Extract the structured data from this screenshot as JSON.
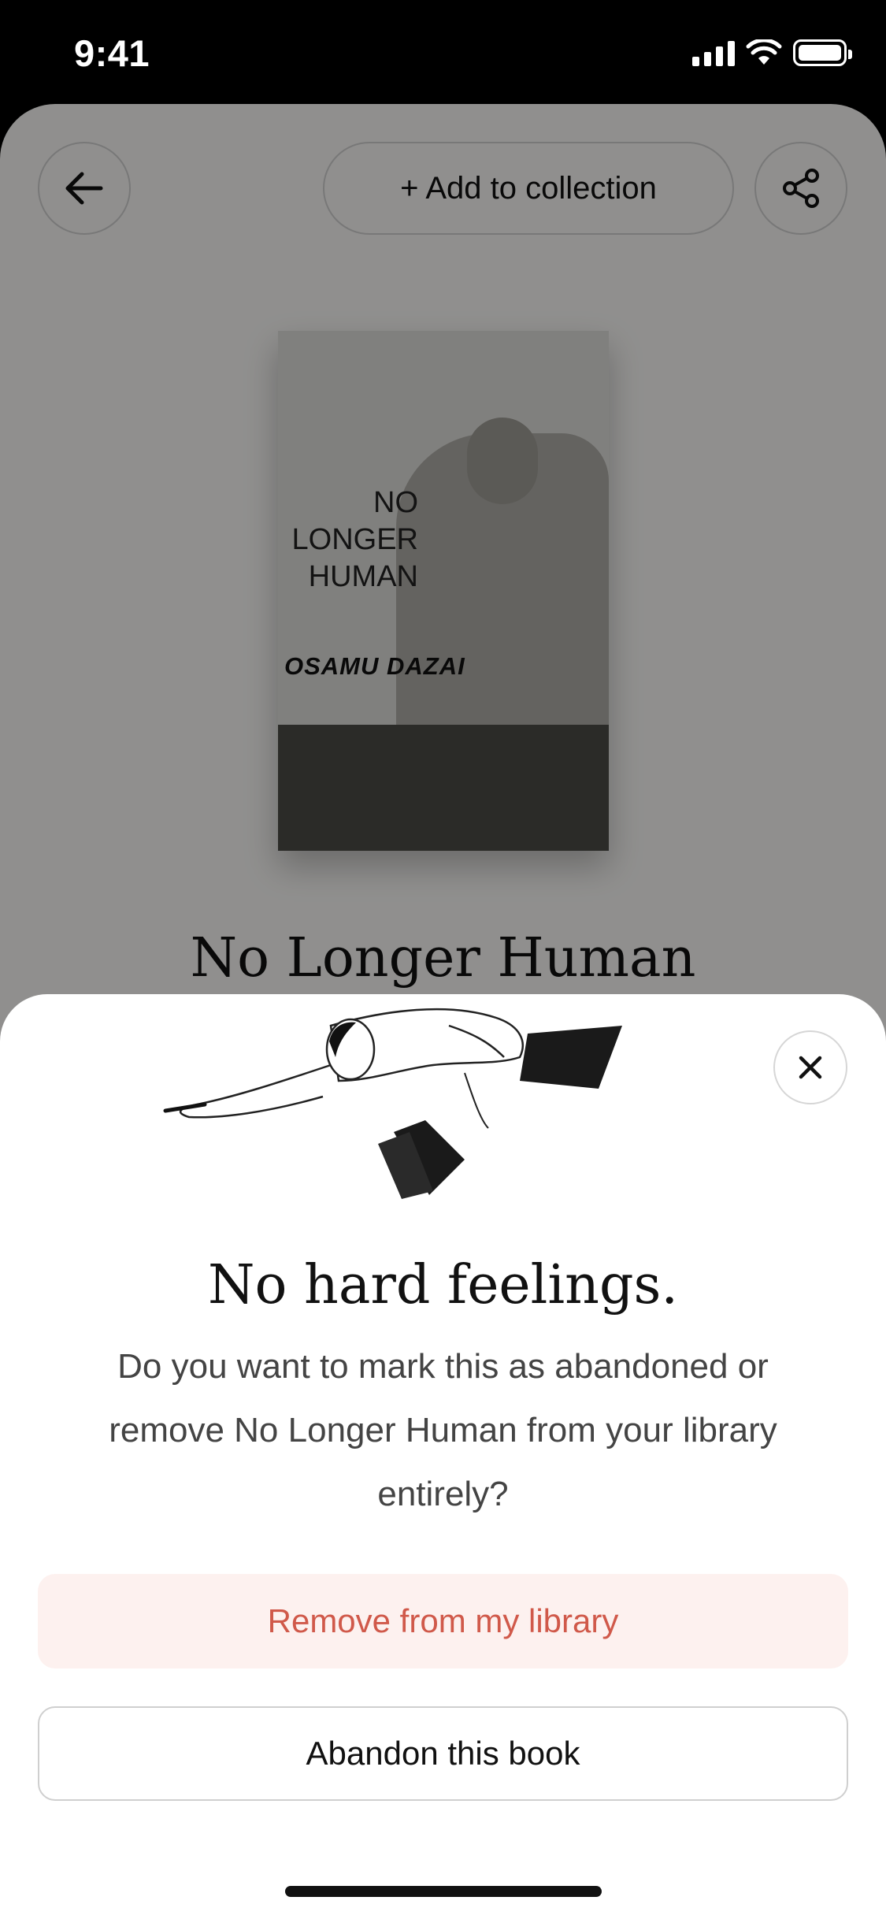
{
  "status_bar": {
    "time": "9:41"
  },
  "header": {
    "add_to_collection_label": "+ Add to collection"
  },
  "book": {
    "title": "No Longer Human",
    "cover_title_lines": [
      "NO",
      "LONGER",
      "HUMAN"
    ],
    "cover_author": "OSAMU DAZAI"
  },
  "sheet": {
    "heading": "No hard feelings.",
    "body": "Do you want to mark this as abandoned or remove No Longer Human from your library entirely?",
    "remove_label": "Remove from my library",
    "abandon_label": "Abandon this book"
  },
  "colors": {
    "remove_text": "#d0594a",
    "remove_bg": "#fdf1ef",
    "page_bg": "#f8f7f5"
  },
  "icons": {
    "back": "arrow-left-icon",
    "share": "share-icon",
    "close": "close-icon"
  }
}
